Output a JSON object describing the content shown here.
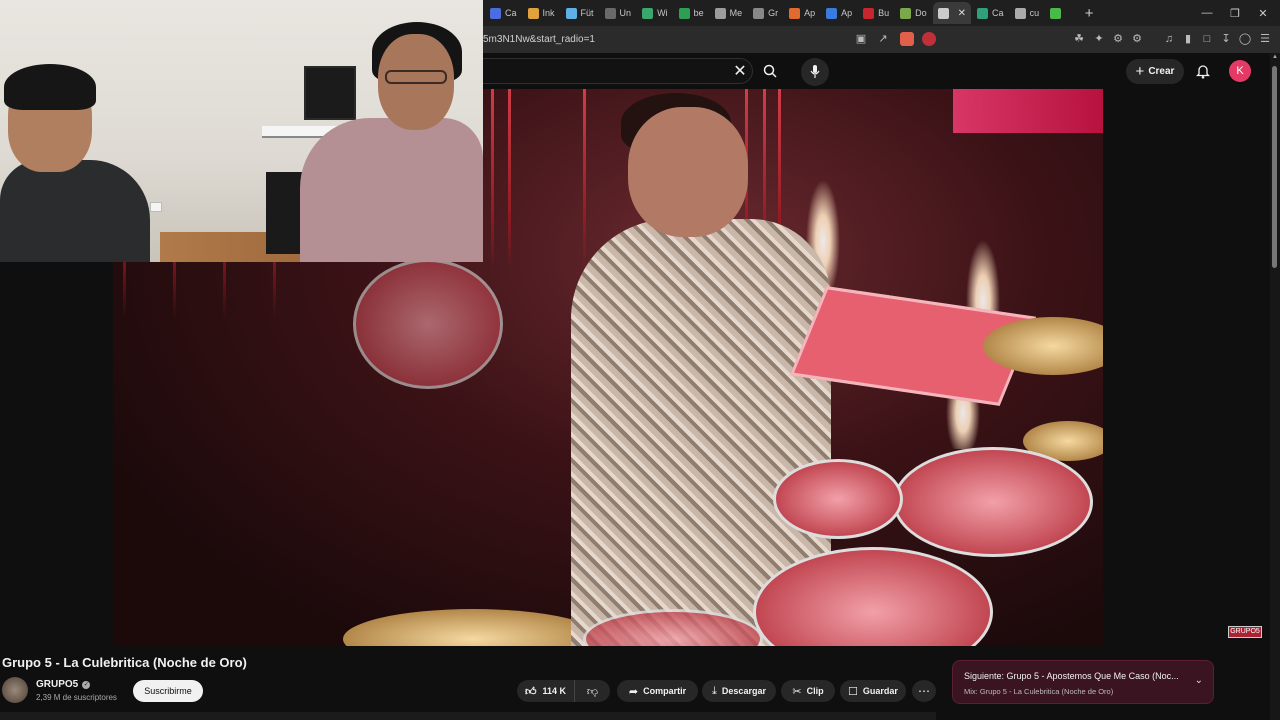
{
  "browser": {
    "tabs": [
      {
        "label": "Ca",
        "color": "#4a6ee0"
      },
      {
        "label": "Ink",
        "color": "#e0a23a"
      },
      {
        "label": "Füt",
        "color": "#5fb0e8"
      },
      {
        "label": "Un",
        "color": "#6a6a6a"
      },
      {
        "label": "Wi",
        "color": "#3aa86c"
      },
      {
        "label": "be",
        "color": "#2f9e55"
      },
      {
        "label": "Me",
        "color": "#9c9c9c"
      },
      {
        "label": "Gr",
        "color": "#888888"
      },
      {
        "label": "Ap",
        "color": "#e06a2f"
      },
      {
        "label": "Ap",
        "color": "#3a7be0"
      },
      {
        "label": "Bu",
        "color": "#c8262e"
      },
      {
        "label": "Do",
        "color": "#7aa84a"
      },
      {
        "label": "",
        "color": "#cccccc",
        "active": true
      },
      {
        "label": "Ca",
        "color": "#2fa07a"
      },
      {
        "label": "cu",
        "color": "#aaaaaa"
      },
      {
        "label": "",
        "color": "#4ab84a"
      }
    ],
    "url": "5m3N1Nw&start_radio=1"
  },
  "header": {
    "create_label": "Crear",
    "avatar_letter": "K"
  },
  "video": {
    "title": "Grupo 5 - La Culebritica (Noche de Oro)",
    "watermark": "GRUPO5"
  },
  "channel": {
    "name": "GRUPO5",
    "subscribers": "2,39 M de suscriptores",
    "subscribe_label": "Suscribirme"
  },
  "actions": {
    "likes": "114 K",
    "share": "Compartir",
    "download": "Descargar",
    "clip": "Clip",
    "save": "Guardar"
  },
  "next": {
    "title": "Siguiente: Grupo 5 - Apostemos Que Me Caso (Noc...",
    "subtitle": "Mix: Grupo 5 - La Culebritica (Noche de Oro)"
  },
  "colors": {
    "accent_avatar": "#e53966",
    "next_card": "#3a1420",
    "background": "#0f0f0f"
  }
}
